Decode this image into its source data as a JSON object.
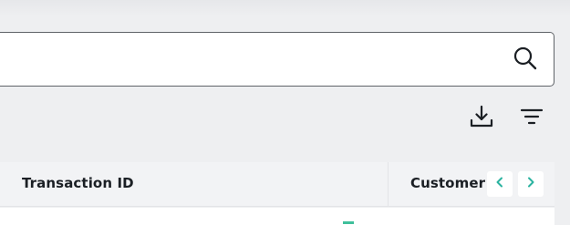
{
  "search": {
    "value": "",
    "placeholder": "",
    "icon": "search-icon"
  },
  "toolbar": {
    "download_icon": "download-icon",
    "filter_icon": "filter-icon"
  },
  "table": {
    "columns": [
      "Transaction ID",
      "Customer"
    ],
    "nav": {
      "prev_icon": "chevron-left-icon",
      "next_icon": "chevron-right-icon"
    }
  },
  "colors": {
    "accent": "#2bb3a0",
    "text": "#1b1f24",
    "background": "#eeeff1"
  }
}
